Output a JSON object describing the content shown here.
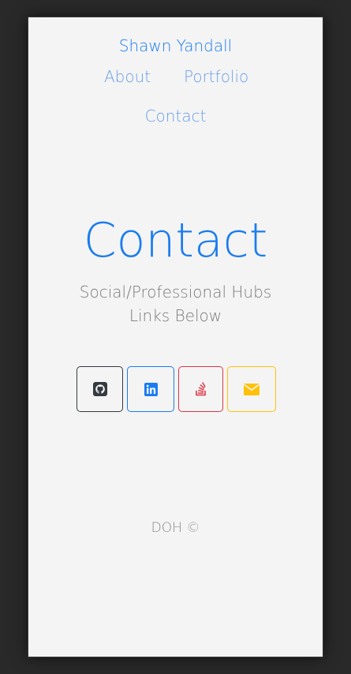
{
  "header": {
    "brand": "Shawn Yandall",
    "nav": {
      "about": "About",
      "portfolio": "Portfolio",
      "contact": "Contact"
    }
  },
  "main": {
    "title": "Contact",
    "subtitle": "Social/Professional Hubs Links Below",
    "social_buttons": [
      {
        "name": "github",
        "icon": "github-icon",
        "color": "#343a40"
      },
      {
        "name": "linkedin",
        "icon": "linkedin-icon",
        "color": "#1a7cf0"
      },
      {
        "name": "stackoverflow",
        "icon": "stackoverflow-icon",
        "color": "#dc3545"
      },
      {
        "name": "email",
        "icon": "envelope-icon",
        "color": "#ffc107"
      }
    ]
  },
  "footer": {
    "text": "DOH ©"
  },
  "colors": {
    "page_background": "#292929",
    "card_background": "#f4f4f4",
    "accent": "#1a7cf0",
    "nav_link": "#6b9fe8",
    "muted_text": "#7b7b7b"
  }
}
